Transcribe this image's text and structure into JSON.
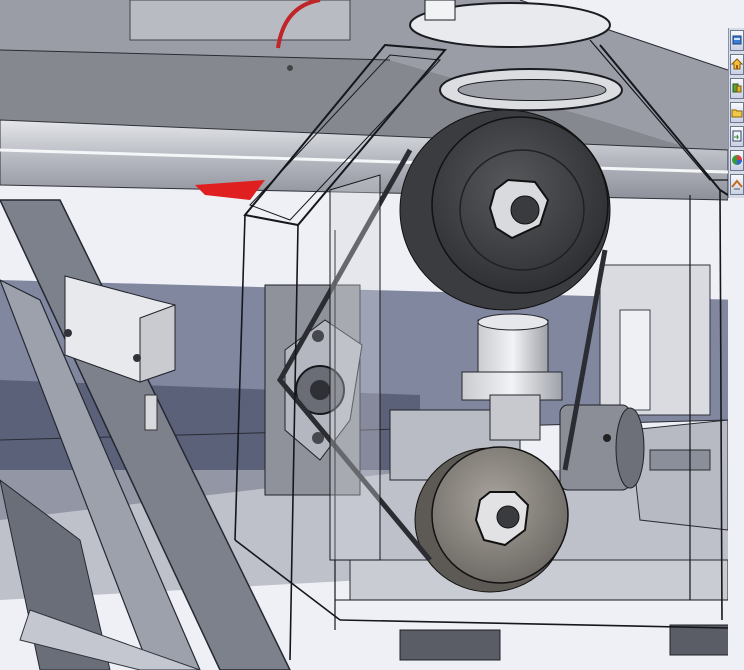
{
  "window": {
    "type": "cad-graphics-area",
    "view": "isometric-shaded-with-transparent-housing"
  },
  "colors": {
    "background": "#eef0f6",
    "frame_steel": "#b3b6bd",
    "plate_grey": "#8e919a",
    "rail_blue": "#6e7490",
    "pulley_dark": "#3e3f43",
    "pulley_tan": "#8f8a84",
    "accent_red": "#e02020",
    "glass_edge": "#1a1c22"
  },
  "taskpane": {
    "tabs": [
      {
        "name": "sw-resources-icon"
      },
      {
        "name": "home-icon"
      },
      {
        "name": "design-library-icon"
      },
      {
        "name": "file-explorer-icon"
      },
      {
        "name": "view-palette-icon"
      },
      {
        "name": "appearances-icon"
      },
      {
        "name": "custom-properties-icon"
      }
    ]
  }
}
